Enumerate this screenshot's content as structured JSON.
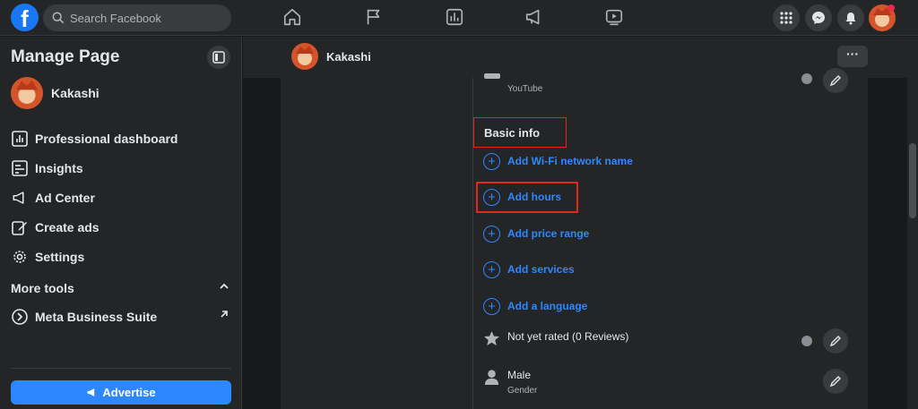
{
  "topbar": {
    "logo": "facebook-logo",
    "logo_letter": "f",
    "search_placeholder": "Search Facebook",
    "nav_icons": [
      "home-icon",
      "flag-icon",
      "chart-icon",
      "megaphone-icon",
      "video-icon"
    ],
    "right_icons": [
      "menu-grid-icon",
      "messenger-icon",
      "bell-icon"
    ],
    "colors": {
      "bg": "#242526",
      "accent": "#1877f2",
      "notification": "#f02849"
    }
  },
  "sidebar": {
    "title": "Manage Page",
    "page_name": "Kakashi",
    "items": [
      {
        "label": "Professional dashboard",
        "icon": "dashboard-icon"
      },
      {
        "label": "Insights",
        "icon": "insights-icon"
      },
      {
        "label": "Ad Center",
        "icon": "megaphone-icon"
      },
      {
        "label": "Create ads",
        "icon": "pencil-icon"
      },
      {
        "label": "Settings",
        "icon": "gear-icon"
      }
    ],
    "more_tools_label": "More tools",
    "tools": [
      {
        "label": "Meta Business Suite",
        "icon": "meta-business-icon"
      }
    ],
    "advertise_label": "Advertise"
  },
  "header": {
    "page_name": "Kakashi",
    "more_label": "···"
  },
  "about": {
    "youtube_label": "YouTube",
    "basic_info_heading": "Basic info",
    "add_items": [
      "Add Wi-Fi network name",
      "Add hours",
      "Add price range",
      "Add services",
      "Add a language"
    ],
    "rating_text": "Not yet rated (0 Reviews)",
    "gender_value": "Male",
    "gender_label": "Gender",
    "highlight_color": "#e0281b",
    "link_color": "#2d88ff"
  }
}
